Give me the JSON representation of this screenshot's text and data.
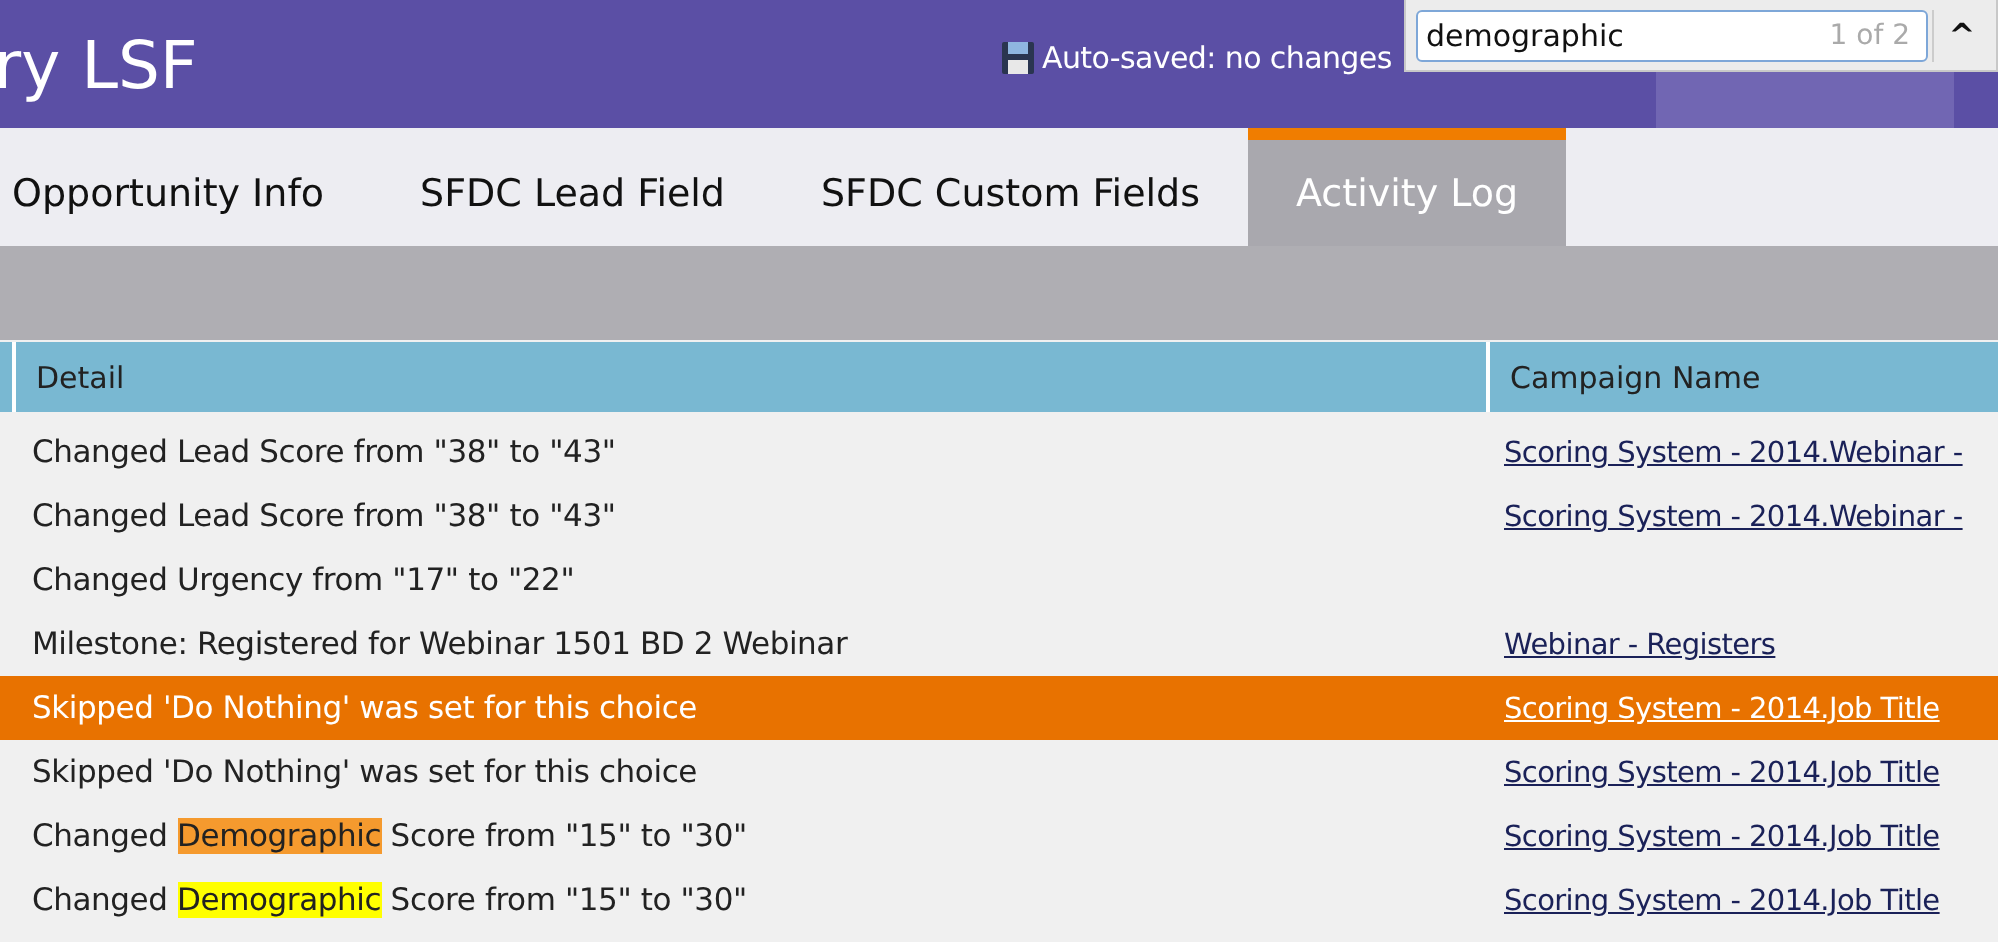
{
  "header": {
    "title": "ry LSF",
    "autosave": "Auto-saved: no changes"
  },
  "find_bar": {
    "value": "demographic",
    "count": "1 of 2",
    "prev_button": "^"
  },
  "tabs": [
    {
      "label": "Opportunity Info",
      "selected": false
    },
    {
      "label": "SFDC Lead Field",
      "selected": false
    },
    {
      "label": "SFDC Custom Fields",
      "selected": false
    },
    {
      "label": "Activity Log",
      "selected": true
    }
  ],
  "table": {
    "columns": [
      "Detail",
      "Campaign Name"
    ],
    "rows": [
      {
        "selected": false,
        "detail": [
          {
            "text": "Changed Lead Score from \"38\" to \"43\""
          }
        ],
        "campaign": "Scoring System - 2014.Webinar -"
      },
      {
        "selected": false,
        "detail": [
          {
            "text": "Changed Lead Score from \"38\" to \"43\""
          }
        ],
        "campaign": "Scoring System - 2014.Webinar -"
      },
      {
        "selected": false,
        "detail": [
          {
            "text": "Changed Urgency from \"17\" to \"22\""
          }
        ]
      },
      {
        "selected": false,
        "detail": [
          {
            "text": "Milestone: Registered for Webinar 1501 BD 2 Webinar"
          }
        ],
        "campaign": "Webinar - Registers"
      },
      {
        "selected": true,
        "detail": [
          {
            "text": "Skipped 'Do Nothing' was set for this choice"
          }
        ],
        "campaign": "Scoring System - 2014.Job Title"
      },
      {
        "selected": false,
        "detail": [
          {
            "text": "Skipped 'Do Nothing' was set for this choice"
          }
        ],
        "campaign": "Scoring System - 2014.Job Title"
      },
      {
        "selected": false,
        "detail": [
          {
            "text": "Changed "
          },
          {
            "text": "Demographic",
            "color": "#f59a2e"
          },
          {
            "text": " Score from \"15\" to \"30\""
          }
        ],
        "campaign": "Scoring System - 2014.Job Title"
      },
      {
        "selected": false,
        "detail": [
          {
            "text": "Changed "
          },
          {
            "text": "Demographic",
            "color": "#ffff00"
          },
          {
            "text": " Score from \"15\" to \"30\""
          }
        ],
        "campaign": "Scoring System - 2014.Job Title"
      }
    ]
  }
}
